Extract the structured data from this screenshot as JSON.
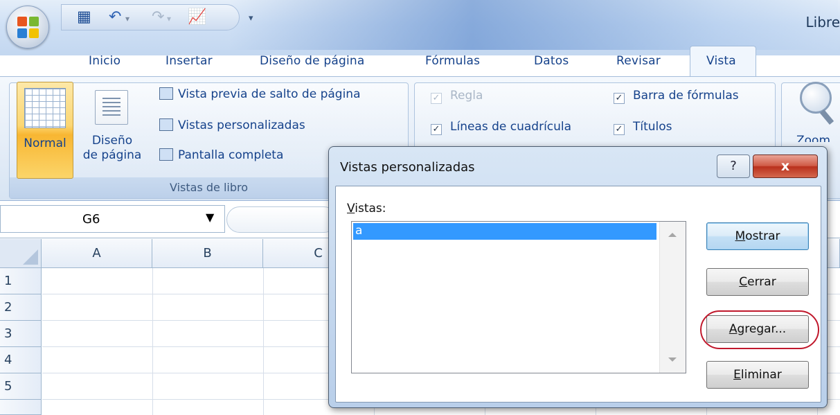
{
  "window": {
    "title_fragment": "Libre"
  },
  "ribbon": {
    "tabs": [
      {
        "label": "Inicio"
      },
      {
        "label": "Insertar"
      },
      {
        "label": "Diseño de página"
      },
      {
        "label": "Fórmulas"
      },
      {
        "label": "Datos"
      },
      {
        "label": "Revisar"
      },
      {
        "label": "Vista",
        "active": true
      }
    ],
    "workbook_views": {
      "caption": "Vistas de libro",
      "normal_label": "Normal",
      "page_layout_label_1": "Diseño",
      "page_layout_label_2": "de página",
      "page_break_preview": "Vista previa de salto de página",
      "custom_views": "Vistas personalizadas",
      "full_screen": "Pantalla completa"
    },
    "show_hide": {
      "ruler": {
        "label": "Regla",
        "checked": true,
        "enabled": false
      },
      "gridlines": {
        "label": "Líneas de cuadrícula",
        "checked": true
      },
      "formula_bar": {
        "label": "Barra de fórmulas",
        "checked": true
      },
      "headings": {
        "label": "Títulos",
        "checked": true
      }
    },
    "zoom_fragment": "Zoom"
  },
  "formula_bar": {
    "name_box": "G6"
  },
  "grid": {
    "columns": [
      "A",
      "B",
      "C"
    ],
    "rows": [
      "1",
      "2",
      "3",
      "4",
      "5"
    ]
  },
  "dialog": {
    "title": "Vistas personalizadas",
    "help": "?",
    "close": "x",
    "views_label_first": "V",
    "views_label_rest": "istas:",
    "views": [
      "a"
    ],
    "buttons": {
      "show": {
        "first": "M",
        "rest": "ostrar"
      },
      "close": {
        "first": "C",
        "rest": "errar"
      },
      "add": {
        "first": "A",
        "rest": "gregar..."
      },
      "delete": {
        "first": "E",
        "rest": "liminar"
      }
    }
  },
  "colors": {
    "accent": "#15428b",
    "highlight_oval": "#c0182c",
    "selection": "#3399ff"
  }
}
